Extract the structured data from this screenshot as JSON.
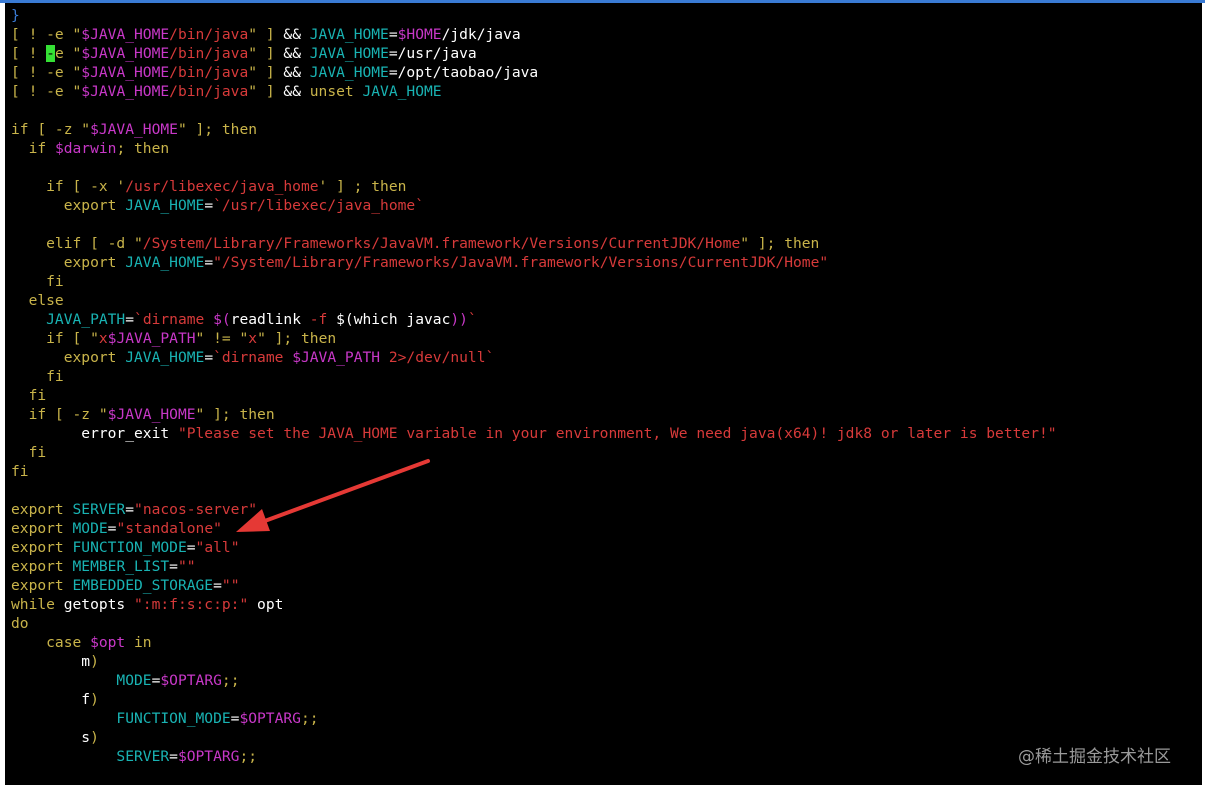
{
  "colors": {
    "keyword": "#c9b44a",
    "variable": "#19b3b3",
    "string": "#d73a3a",
    "dollar_var": "#c838c8",
    "plain": "#ffffff",
    "cursor": "#35e035",
    "annotation_arrow": "#e53935",
    "background": "#000000"
  },
  "code_lines": [
    [
      [
        "b",
        "}"
      ]
    ],
    [
      [
        "y",
        "[ ! -e \""
      ],
      [
        "m",
        "$JAVA_HOME"
      ],
      [
        "r",
        "/bin/java"
      ],
      [
        "y",
        "\" ] "
      ],
      [
        "w",
        "&& "
      ],
      [
        "c",
        "JAVA_HOME"
      ],
      [
        "w",
        "="
      ],
      [
        "m",
        "$HOME"
      ],
      [
        "w",
        "/jdk/java"
      ]
    ],
    [
      [
        "y",
        "[ ! "
      ],
      [
        "cur",
        "-"
      ],
      [
        "y",
        "e \""
      ],
      [
        "m",
        "$JAVA_HOME"
      ],
      [
        "r",
        "/bin/java"
      ],
      [
        "y",
        "\" ] "
      ],
      [
        "w",
        "&& "
      ],
      [
        "c",
        "JAVA_HOME"
      ],
      [
        "w",
        "=/usr/java"
      ]
    ],
    [
      [
        "y",
        "[ ! -e \""
      ],
      [
        "m",
        "$JAVA_HOME"
      ],
      [
        "r",
        "/bin/java"
      ],
      [
        "y",
        "\" ] "
      ],
      [
        "w",
        "&& "
      ],
      [
        "c",
        "JAVA_HOME"
      ],
      [
        "w",
        "=/opt/taobao/java"
      ]
    ],
    [
      [
        "y",
        "[ ! -e \""
      ],
      [
        "m",
        "$JAVA_HOME"
      ],
      [
        "r",
        "/bin/java"
      ],
      [
        "y",
        "\" ] "
      ],
      [
        "w",
        "&& "
      ],
      [
        "y",
        "unset "
      ],
      [
        "c",
        "JAVA_HOME"
      ]
    ],
    [],
    [
      [
        "y",
        "if [ -z \""
      ],
      [
        "m",
        "$JAVA_HOME"
      ],
      [
        "y",
        "\" ]; then"
      ]
    ],
    [
      [
        "y",
        "  if "
      ],
      [
        "m",
        "$darwin"
      ],
      [
        "y",
        "; then"
      ]
    ],
    [],
    [
      [
        "y",
        "    if [ -x '"
      ],
      [
        "r",
        "/usr/libexec/java_home"
      ],
      [
        "y",
        "' ] ; then"
      ]
    ],
    [
      [
        "y",
        "      export "
      ],
      [
        "c",
        "JAVA_HOME"
      ],
      [
        "w",
        "="
      ],
      [
        "r",
        "`/usr/libexec/java_home`"
      ]
    ],
    [],
    [
      [
        "y",
        "    elif [ -d \""
      ],
      [
        "r",
        "/System/Library/Frameworks/JavaVM.framework/Versions/CurrentJDK/Home"
      ],
      [
        "y",
        "\" ]; then"
      ]
    ],
    [
      [
        "y",
        "      export "
      ],
      [
        "c",
        "JAVA_HOME"
      ],
      [
        "w",
        "="
      ],
      [
        "r",
        "\"/System/Library/Frameworks/JavaVM.framework/Versions/CurrentJDK/Home\""
      ]
    ],
    [
      [
        "y",
        "    fi"
      ]
    ],
    [
      [
        "y",
        "  else"
      ]
    ],
    [
      [
        "c",
        "    JAVA_PATH"
      ],
      [
        "w",
        "="
      ],
      [
        "r",
        "`dirname "
      ],
      [
        "m",
        "$("
      ],
      [
        "w",
        "readlink "
      ],
      [
        "r",
        "-f "
      ],
      [
        "w",
        "$("
      ],
      [
        "w",
        "which javac"
      ],
      [
        "m",
        "))"
      ],
      [
        "r",
        "`"
      ]
    ],
    [
      [
        "y",
        "    if [ \""
      ],
      [
        "r",
        "x"
      ],
      [
        "m",
        "$JAVA_PATH"
      ],
      [
        "y",
        "\" != \""
      ],
      [
        "r",
        "x"
      ],
      [
        "y",
        "\" ]; then"
      ]
    ],
    [
      [
        "y",
        "      export "
      ],
      [
        "c",
        "JAVA_HOME"
      ],
      [
        "w",
        "="
      ],
      [
        "r",
        "`dirname "
      ],
      [
        "m",
        "$JAVA_PATH"
      ],
      [
        "r",
        " 2>/dev/null`"
      ]
    ],
    [
      [
        "y",
        "    fi"
      ]
    ],
    [
      [
        "y",
        "  fi"
      ]
    ],
    [
      [
        "y",
        "  if [ -z \""
      ],
      [
        "m",
        "$JAVA_HOME"
      ],
      [
        "y",
        "\" ]; then"
      ]
    ],
    [
      [
        "w",
        "        error_exit "
      ],
      [
        "r",
        "\"Please set the JAVA_HOME variable in your environment, We need java(x64)! jdk8 or later is better!\""
      ]
    ],
    [
      [
        "y",
        "  fi"
      ]
    ],
    [
      [
        "y",
        "fi"
      ]
    ],
    [],
    [
      [
        "y",
        "export "
      ],
      [
        "c",
        "SERVER"
      ],
      [
        "w",
        "="
      ],
      [
        "r",
        "\"nacos-server\""
      ]
    ],
    [
      [
        "y",
        "export "
      ],
      [
        "c",
        "MODE"
      ],
      [
        "w",
        "="
      ],
      [
        "r",
        "\"standalone\""
      ]
    ],
    [
      [
        "y",
        "export "
      ],
      [
        "c",
        "FUNCTION_MODE"
      ],
      [
        "w",
        "="
      ],
      [
        "r",
        "\"all\""
      ]
    ],
    [
      [
        "y",
        "export "
      ],
      [
        "c",
        "MEMBER_LIST"
      ],
      [
        "w",
        "="
      ],
      [
        "r",
        "\"\""
      ]
    ],
    [
      [
        "y",
        "export "
      ],
      [
        "c",
        "EMBEDDED_STORAGE"
      ],
      [
        "w",
        "="
      ],
      [
        "r",
        "\"\""
      ]
    ],
    [
      [
        "y",
        "while "
      ],
      [
        "w",
        "getopts "
      ],
      [
        "r",
        "\":m:f:s:c:p:\""
      ],
      [
        "w",
        " opt"
      ]
    ],
    [
      [
        "y",
        "do"
      ]
    ],
    [
      [
        "y",
        "    case "
      ],
      [
        "m",
        "$opt"
      ],
      [
        "y",
        " in"
      ]
    ],
    [
      [
        "w",
        "        m"
      ],
      [
        "y",
        ")"
      ]
    ],
    [
      [
        "c",
        "            MODE"
      ],
      [
        "w",
        "="
      ],
      [
        "m",
        "$OPTARG"
      ],
      [
        "y",
        ";;"
      ]
    ],
    [
      [
        "w",
        "        f"
      ],
      [
        "y",
        ")"
      ]
    ],
    [
      [
        "c",
        "            FUNCTION_MODE"
      ],
      [
        "w",
        "="
      ],
      [
        "m",
        "$OPTARG"
      ],
      [
        "y",
        ";;"
      ]
    ],
    [
      [
        "w",
        "        s"
      ],
      [
        "y",
        ")"
      ]
    ],
    [
      [
        "c",
        "            SERVER"
      ],
      [
        "w",
        "="
      ],
      [
        "m",
        "$OPTARG"
      ],
      [
        "y",
        ";;"
      ]
    ]
  ],
  "watermark": "@稀土掘金技术社区"
}
